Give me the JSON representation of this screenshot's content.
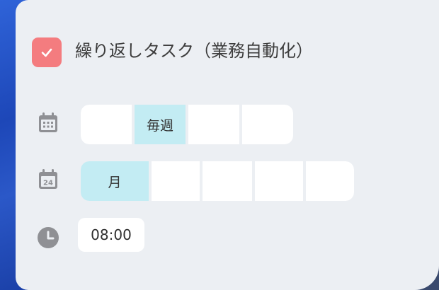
{
  "task": {
    "checked": true,
    "title": "繰り返しタスク（業務自動化）"
  },
  "frequency": {
    "options": [
      "",
      "毎週",
      "",
      ""
    ],
    "selected_index": 1
  },
  "day_of_week": {
    "calendar_icon_day": "24",
    "options": [
      "月",
      "",
      "",
      "",
      ""
    ],
    "selected_index": 0
  },
  "time": {
    "value": "08:00"
  },
  "colors": {
    "accent_check": "#f47c7f",
    "selected_segment": "#c3ecf3",
    "card_background": "#eceff3"
  }
}
